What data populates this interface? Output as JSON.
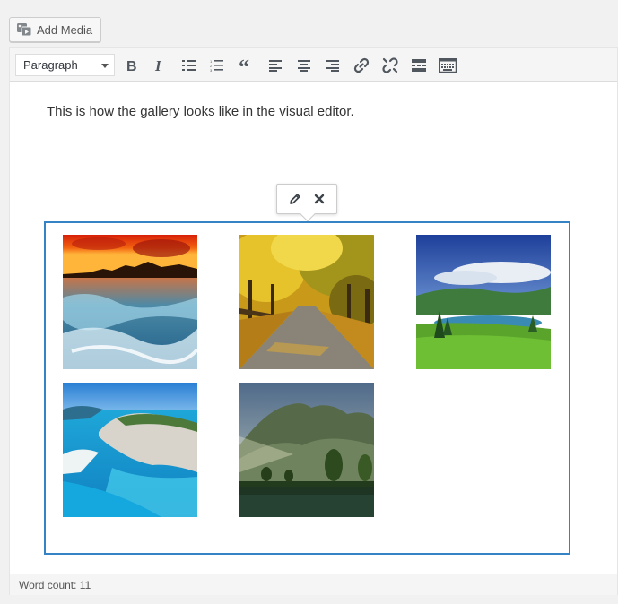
{
  "add_media": {
    "label": "Add Media",
    "icon": "media-icon"
  },
  "toolbar": {
    "format_select": {
      "value": "Paragraph"
    },
    "buttons": [
      {
        "name": "bold-icon",
        "title": "Bold"
      },
      {
        "name": "italic-icon",
        "title": "Italic"
      },
      {
        "name": "bulleted-list-icon",
        "title": "Bulleted list"
      },
      {
        "name": "numbered-list-icon",
        "title": "Numbered list"
      },
      {
        "name": "blockquote-icon",
        "title": "Blockquote"
      },
      {
        "name": "align-left-icon",
        "title": "Align left"
      },
      {
        "name": "align-center-icon",
        "title": "Align center"
      },
      {
        "name": "align-right-icon",
        "title": "Align right"
      },
      {
        "name": "insert-link-icon",
        "title": "Insert/edit link"
      },
      {
        "name": "remove-link-icon",
        "title": "Remove link"
      },
      {
        "name": "read-more-icon",
        "title": "Insert Read More tag"
      },
      {
        "name": "toolbar-toggle-icon",
        "title": "Toolbar Toggle"
      }
    ]
  },
  "content": {
    "paragraph": "This is how the gallery looks like in the visual editor."
  },
  "gallery_toolbar": {
    "edit_icon": "pencil-icon",
    "remove_icon": "close-icon"
  },
  "gallery": {
    "images": [
      {
        "name": "sunset-sea-waves"
      },
      {
        "name": "autumn-tree-road"
      },
      {
        "name": "green-valley-lake"
      },
      {
        "name": "bay-cliff-beach"
      },
      {
        "name": "misty-mountain-lake"
      }
    ]
  },
  "status": {
    "word_count": "Word count: 11"
  }
}
